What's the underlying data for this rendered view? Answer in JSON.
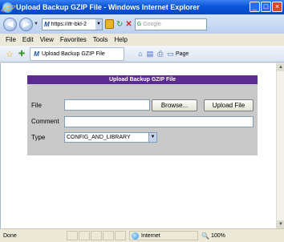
{
  "window": {
    "title": "Upload Backup GZIP File - Windows Internet Explorer",
    "controls": {
      "minimize": "_",
      "maximize": "□",
      "close": "×"
    }
  },
  "address_bar": {
    "url": "https://ifr-bkl-2",
    "search_placeholder": "Google",
    "back_glyph": "◀",
    "forward_glyph": "▶",
    "dropdown_glyph": "▼",
    "refresh_glyph": "↻",
    "stop_glyph": "✕",
    "search_glyph": "G"
  },
  "menu": {
    "items": [
      "File",
      "Edit",
      "View",
      "Favorites",
      "Tools",
      "Help"
    ]
  },
  "command_bar": {
    "tab_label": "Upload Backup GZIP File",
    "tab_icon": "M",
    "star_glyph": "☆",
    "add_fav_glyph": "✚",
    "home_glyph": "⌂",
    "feeds_glyph": "▤",
    "print_glyph": "⎙",
    "page_glyph": "▭",
    "page_label": "Page"
  },
  "form": {
    "header": "Upload Backup GZIP File",
    "file_label": "File",
    "file_value": "",
    "browse_label": "Browse...",
    "upload_label": "Upload File",
    "comment_label": "Comment",
    "comment_value": "",
    "type_label": "Type",
    "type_value": "CONFIG_AND_LIBRARY",
    "dropdown_glyph": "▼"
  },
  "status_bar": {
    "status": "Done",
    "zone": "Internet",
    "zoom": "100%",
    "zoom_glyph": "🔍"
  },
  "colors": {
    "title_bar": "#0a55d8",
    "panel_header": "#5c2b91",
    "panel_bg": "#c9c9c9"
  }
}
